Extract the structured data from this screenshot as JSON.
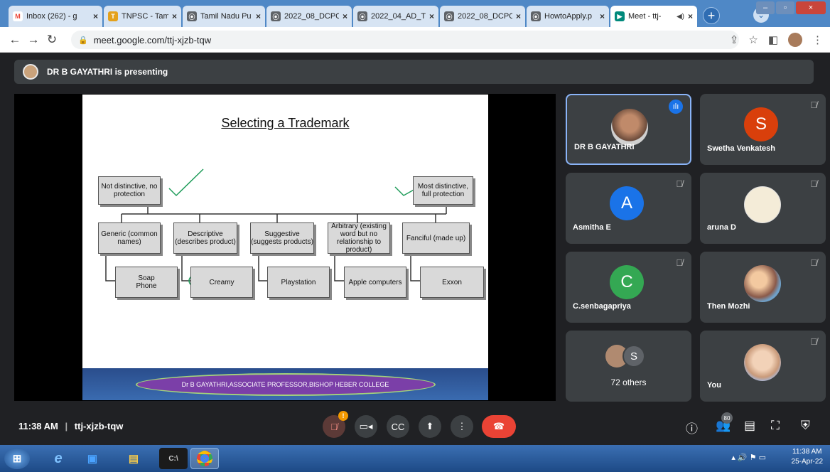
{
  "browser": {
    "tabs": [
      {
        "label": "Inbox (262) - g",
        "fav": "M",
        "fav_color": "#ea4335"
      },
      {
        "label": "TNPSC - Tamil",
        "fav": "T",
        "fav_color": "#e4a11b"
      },
      {
        "label": "Tamil Nadu Pu",
        "fav": "⦿",
        "fav_color": "#5f6368"
      },
      {
        "label": "2022_08_DCPC",
        "fav": "⦿",
        "fav_color": "#5f6368"
      },
      {
        "label": "2022_04_AD_T",
        "fav": "⦿",
        "fav_color": "#5f6368"
      },
      {
        "label": "2022_08_DCPC",
        "fav": "⦿",
        "fav_color": "#5f6368"
      },
      {
        "label": "HowtoApply.p",
        "fav": "⦿",
        "fav_color": "#5f6368"
      },
      {
        "label": "Meet - ttj-",
        "fav": "▶",
        "fav_color": "#00897b"
      }
    ],
    "url": "meet.google.com/ttj-xjzb-tqw"
  },
  "presenting": {
    "text": "DR B GAYATHRI is presenting"
  },
  "slide": {
    "title": "Selecting a Trademark",
    "left_box": "Not distinctive, no protection",
    "right_box": "Most distinctive, full protection",
    "categories": [
      "Generic (common names)",
      "Descriptive (describes product)",
      "Suggestive (suggests products)",
      "Arbitrary (existing word but no relationship to product)",
      "Fanciful (made up)"
    ],
    "examples": [
      "Soap Phone",
      "Creamy",
      "Playstation",
      "Apple computers",
      "Exxon"
    ],
    "footer": "Dr B GAYATHRI,ASSOCIATE PROFESSOR,BISHOP HEBER COLLEGE"
  },
  "participants": [
    {
      "name": "DR B GAYATHRI",
      "letter": "",
      "color": "#8a5a3c",
      "muted": false,
      "speaking": true
    },
    {
      "name": "Swetha Venkatesh",
      "letter": "S",
      "color": "#d93f0b",
      "muted": true
    },
    {
      "name": "Asmitha E",
      "letter": "A",
      "color": "#1a73e8",
      "muted": true
    },
    {
      "name": "aruna D",
      "letter": "",
      "color": "#f0e6d0",
      "muted": true
    },
    {
      "name": "C.senbagapriya",
      "letter": "C",
      "color": "#34a853",
      "muted": true
    },
    {
      "name": "Then Mozhi",
      "letter": "",
      "color": "#e09b6b",
      "muted": true
    },
    {
      "name": "72 others",
      "letter": "S",
      "color": "#5f6368",
      "muted": false
    },
    {
      "name": "You",
      "letter": "",
      "color": "#c99a7a",
      "muted": true
    }
  ],
  "meeting": {
    "time": "11:38 AM",
    "code": "ttj-xjzb-tqw",
    "people_count": "80"
  },
  "taskbar": {
    "time": "11:38 AM",
    "date": "25-Apr-22"
  }
}
